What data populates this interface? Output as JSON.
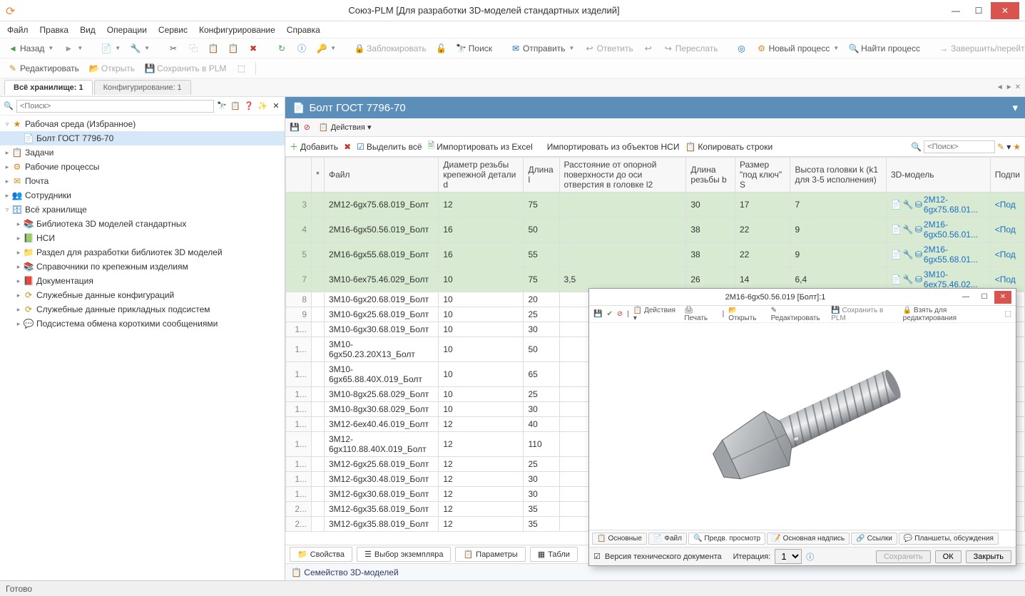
{
  "window": {
    "title": "Союз-PLM [Для разработки 3D-моделей стандартных изделий]"
  },
  "menu": [
    "Файл",
    "Правка",
    "Вид",
    "Операции",
    "Сервис",
    "Конфигурирование",
    "Справка"
  ],
  "toolbar1": {
    "back": "Назад",
    "lock": "Заблокировать",
    "search": "Поиск",
    "send": "Отправить",
    "reply": "Ответить",
    "forward": "Переслать",
    "newproc": "Новый процесс",
    "findproc": "Найти процесс",
    "finish": "Завершить/перейти к"
  },
  "toolbar2": {
    "edit": "Редактировать",
    "open": "Открыть",
    "save": "Сохранить в PLM"
  },
  "tabs": {
    "active": "Всё хранилище: 1",
    "inactive": "Конфигурирование: 1"
  },
  "sidebar": {
    "search_placeholder": "<Поиск>",
    "nodes": {
      "fav": "Рабочая среда (Избранное)",
      "bolt": "Болт ГОСТ 7796-70",
      "tasks": "Задачи",
      "procs": "Рабочие процессы",
      "mail": "Почта",
      "staff": "Сотрудники",
      "storage": "Всё хранилище",
      "lib3d": "Библиотека 3D моделей стандартных",
      "nsi": "НСИ",
      "section": "Раздел для разработки библиотек 3D моделей",
      "refs": "Справочники по крепежным изделиям",
      "docs": "Документация",
      "svc_cfg": "Служебные данные конфигураций",
      "svc_app": "Служебные данные прикладных подсистем",
      "msg": "Подсистема обмена короткими сообщениями"
    }
  },
  "content": {
    "title": "Болт ГОСТ 7796-70",
    "actions": "Действия",
    "toolbar": {
      "add": "Добавить",
      "select_all": "Выделить всё",
      "import_excel": "Импортировать из Excel",
      "import_nsi": "Импортировать из объектов НСИ",
      "copy_rows": "Копировать строки",
      "search_placeholder": "<Поиск>"
    },
    "columns": {
      "star": "*",
      "file": "Файл",
      "diam": "Диаметр резьбы крепежной детали d",
      "lenl": "Длина l",
      "dist": "Расстояние от опорной поверхности до оси отверстия в головке l2",
      "lenb": "Длина резьбы b",
      "size_s": "Размер \"под ключ\" S",
      "head_k": "Высота головки k (k1 для 3-5 исполнения)",
      "model": "3D-модель",
      "sign": "Подпи"
    },
    "rows": [
      {
        "n": "3",
        "file": "2М12-6gх75.68.019_Болт",
        "d": "12",
        "l": "75",
        "l2": "",
        "b": "30",
        "s": "17",
        "k": "7",
        "model": "2М12-6gх75.68.01...",
        "sign": "<Под",
        "hl": true
      },
      {
        "n": "4",
        "file": "2М16-6gх50.56.019_Болт",
        "d": "16",
        "l": "50",
        "l2": "",
        "b": "38",
        "s": "22",
        "k": "9",
        "model": "2М16-6gх50.56.01...",
        "sign": "<Под",
        "hl": true
      },
      {
        "n": "5",
        "file": "2М16-6gх55.68.019_Болт",
        "d": "16",
        "l": "55",
        "l2": "",
        "b": "38",
        "s": "22",
        "k": "9",
        "model": "2М16-6gх55.68.01...",
        "sign": "<Под",
        "hl": true
      },
      {
        "n": "7",
        "file": "3М10-6ех75.46.029_Болт",
        "d": "10",
        "l": "75",
        "l2": "3,5",
        "b": "26",
        "s": "14",
        "k": "6,4",
        "model": "3М10-6ех75.46.02...",
        "sign": "<Под",
        "hl": true
      },
      {
        "n": "8",
        "file": "3М10-6gх20.68.019_Болт",
        "d": "10",
        "l": "20",
        "l2": "",
        "b": "",
        "s": "",
        "k": "",
        "model": "",
        "sign": "",
        "hl": false
      },
      {
        "n": "9",
        "file": "3М10-6gх25.68.019_Болт",
        "d": "10",
        "l": "25",
        "l2": "",
        "b": "",
        "s": "",
        "k": "",
        "model": "",
        "sign": "",
        "hl": false
      },
      {
        "n": "1...",
        "file": "3М10-6gх30.68.019_Болт",
        "d": "10",
        "l": "30",
        "l2": "",
        "b": "",
        "s": "",
        "k": "",
        "model": "",
        "sign": "",
        "hl": false
      },
      {
        "n": "1...",
        "file": "3М10-6gх50.23.20Х13_Болт",
        "d": "10",
        "l": "50",
        "l2": "",
        "b": "",
        "s": "",
        "k": "",
        "model": "",
        "sign": "",
        "hl": false
      },
      {
        "n": "1...",
        "file": "3М10-6gх65.88.40Х.019_Болт",
        "d": "10",
        "l": "65",
        "l2": "",
        "b": "",
        "s": "",
        "k": "",
        "model": "",
        "sign": "",
        "hl": false
      },
      {
        "n": "1...",
        "file": "3М10-8gх25.68.029_Болт",
        "d": "10",
        "l": "25",
        "l2": "",
        "b": "",
        "s": "",
        "k": "",
        "model": "",
        "sign": "",
        "hl": false
      },
      {
        "n": "1...",
        "file": "3М10-8gх30.68.029_Болт",
        "d": "10",
        "l": "30",
        "l2": "",
        "b": "",
        "s": "",
        "k": "",
        "model": "",
        "sign": "",
        "hl": false
      },
      {
        "n": "1...",
        "file": "3М12-6ех40.46.019_Болт",
        "d": "12",
        "l": "40",
        "l2": "",
        "b": "",
        "s": "",
        "k": "",
        "model": "",
        "sign": "",
        "hl": false
      },
      {
        "n": "1...",
        "file": "3М12-6gх110.88.40Х.019_Болт",
        "d": "12",
        "l": "110",
        "l2": "",
        "b": "",
        "s": "",
        "k": "",
        "model": "",
        "sign": "",
        "hl": false
      },
      {
        "n": "1...",
        "file": "3М12-6gх25.68.019_Болт",
        "d": "12",
        "l": "25",
        "l2": "",
        "b": "",
        "s": "",
        "k": "",
        "model": "",
        "sign": "",
        "hl": false
      },
      {
        "n": "1...",
        "file": "3М12-6gх30.48.019_Болт",
        "d": "12",
        "l": "30",
        "l2": "",
        "b": "",
        "s": "",
        "k": "",
        "model": "",
        "sign": "",
        "hl": false
      },
      {
        "n": "1...",
        "file": "3М12-6gх30.68.019_Болт",
        "d": "12",
        "l": "30",
        "l2": "",
        "b": "",
        "s": "",
        "k": "",
        "model": "",
        "sign": "",
        "hl": false
      },
      {
        "n": "2...",
        "file": "3М12-6gх35.68.019_Болт",
        "d": "12",
        "l": "35",
        "l2": "",
        "b": "",
        "s": "",
        "k": "",
        "model": "",
        "sign": "",
        "hl": false
      },
      {
        "n": "2...",
        "file": "3М12-6gх35.88.019_Болт",
        "d": "12",
        "l": "35",
        "l2": "",
        "b": "",
        "s": "",
        "k": "",
        "model": "",
        "sign": "",
        "hl": false
      }
    ],
    "bottom_tabs": [
      "Свойства",
      "Выбор экземпляра",
      "Параметры",
      "Табли"
    ],
    "footer": "Семейство 3D-моделей"
  },
  "preview": {
    "title": "2М16-6gх50.56.019 [Болт]:1",
    "tb": {
      "actions": "Действия",
      "print": "Печать",
      "open": "Открыть",
      "edit": "Редактировать",
      "save": "Сохранить в PLM",
      "take": "Взять для редактирования"
    },
    "tabs": [
      "Основные",
      "Файл",
      "Предв. просмотр",
      "Основная надпись",
      "Ссылки",
      "Планшеты, обсуждения"
    ],
    "foot": {
      "doc_ver": "Версия технического документа",
      "iter": "Итерация:",
      "iter_val": "1",
      "save": "Сохранить",
      "ok": "ОК",
      "close": "Закрыть"
    }
  },
  "status": "Готово"
}
